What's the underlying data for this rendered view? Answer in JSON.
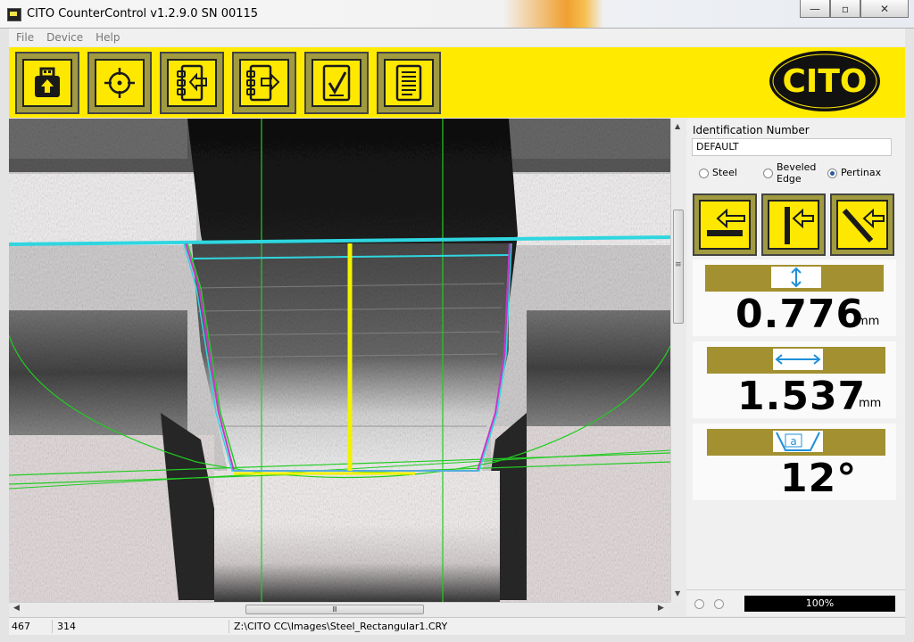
{
  "window": {
    "title": "CITO CounterControl v1.2.9.0 SN 00115",
    "minimize_glyph": "—",
    "maximize_glyph": "▫",
    "close_glyph": "✕"
  },
  "menu": {
    "items": [
      "File",
      "Device",
      "Help"
    ]
  },
  "toolbar": {
    "buttons": [
      {
        "icon": "usb-upload-icon"
      },
      {
        "icon": "crosshair-target-icon"
      },
      {
        "icon": "import-list-icon"
      },
      {
        "icon": "export-list-icon"
      },
      {
        "icon": "checklist-icon"
      },
      {
        "icon": "report-document-icon"
      }
    ],
    "logo_text": "CITO"
  },
  "panel": {
    "id_label": "Identification Number",
    "id_value": "DEFAULT",
    "materials": [
      {
        "label": "Steel",
        "selected": false
      },
      {
        "label": "Beveled Edge",
        "label_line1": "Beveled",
        "label_line2": "Edge",
        "selected": false
      },
      {
        "label": "Pertinax",
        "selected": true
      }
    ],
    "mode_buttons": [
      {
        "icon": "horizontal-measure-icon"
      },
      {
        "icon": "vertical-measure-icon"
      },
      {
        "icon": "diagonal-measure-icon"
      }
    ],
    "measurements": [
      {
        "icon": "vertical-arrow-icon",
        "value": "0.776",
        "unit": "mm"
      },
      {
        "icon": "horizontal-arrow-icon",
        "value": "1.537",
        "unit": "mm"
      },
      {
        "icon": "angle-alpha-icon",
        "value": "12°",
        "unit": ""
      }
    ],
    "angle_symbol": "a",
    "progress_text": "100%"
  },
  "status": {
    "x": "467",
    "y": "314",
    "file_path": "Z:\\CITO CC\\Images\\Steel_Rectangular1.CRY"
  },
  "scroll": {
    "grip": "Ⅲ",
    "grip_v": "≡"
  },
  "colors": {
    "toolbar_yellow": "#ffea00",
    "button_olive": "#a09a40",
    "measure_bar": "#a39030",
    "cyan_line": "#2fd6e0",
    "green_line": "#22cc22",
    "yellow_line": "#f2f200"
  }
}
